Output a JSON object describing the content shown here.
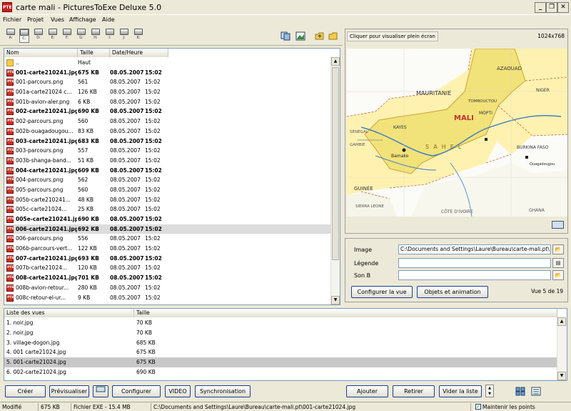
{
  "window": {
    "title": "carte mali - PicturesToExe Deluxe 5.0",
    "icon_text": "PTE"
  },
  "menu": [
    "Fichier",
    "Projet",
    "Vues",
    "Affichage",
    "Aide"
  ],
  "drives": [
    "A:",
    "C:",
    "D:",
    "E:",
    "F:",
    "G:",
    "H:",
    "I:",
    "J:",
    "K:"
  ],
  "filelist": {
    "headers": {
      "name": "Nom",
      "size": "Taille",
      "date": "Date/Heure"
    },
    "rows": [
      {
        "name": "..",
        "size": "Haut",
        "date": "",
        "time": "",
        "icon": "folder-icon"
      },
      {
        "name": "001-carte210241.jpg",
        "size": "675 KB",
        "date": "08.05.2007",
        "time": "15:02",
        "bold": true
      },
      {
        "name": "001-parcours.png",
        "size": "561",
        "date": "08.05.2007",
        "time": "15:02"
      },
      {
        "name": "001a-carte21024 c...",
        "size": "126 KB",
        "date": "08.05.2007",
        "time": "15:02"
      },
      {
        "name": "001b-avion-aler.png",
        "size": "6 KB",
        "date": "08.05.2007",
        "time": "15:02"
      },
      {
        "name": "002-carte210241.jpg",
        "size": "690 KB",
        "date": "08.05.2007",
        "time": "15:02",
        "bold": true
      },
      {
        "name": "002-parcours.png",
        "size": "560",
        "date": "08.05.2007",
        "time": "15:02"
      },
      {
        "name": "002b-ouagadougou...",
        "size": "83 KB",
        "date": "08.05.2007",
        "time": "15:02"
      },
      {
        "name": "003-carte210241.jpg",
        "size": "683 KB",
        "date": "08.05.2007",
        "time": "15:02",
        "bold": true
      },
      {
        "name": "003-parcours.png",
        "size": "557",
        "date": "08.05.2007",
        "time": "15:02"
      },
      {
        "name": "003b-shanga-band...",
        "size": "51 KB",
        "date": "08.05.2007",
        "time": "15:02"
      },
      {
        "name": "004-carte210241.jpg",
        "size": "609 KB",
        "date": "08.05.2007",
        "time": "15:02",
        "bold": true
      },
      {
        "name": "004-parcours.png",
        "size": "562",
        "date": "08.05.2007",
        "time": "15:02"
      },
      {
        "name": "005-parcours.png",
        "size": "560",
        "date": "08.05.2007",
        "time": "15:02"
      },
      {
        "name": "005b-carte210241...",
        "size": "48 KB",
        "date": "08.05.2007",
        "time": "15:02"
      },
      {
        "name": "005c-carte21024...",
        "size": "25 KB",
        "date": "08.05.2007",
        "time": "15:02"
      },
      {
        "name": "005e-carte210241.jpg",
        "size": "690 KB",
        "date": "08.05.2007",
        "time": "15:02",
        "bold": true
      },
      {
        "name": "006-carte210241.jpg",
        "size": "692 KB",
        "date": "08.05.2007",
        "time": "15:02",
        "bold": true,
        "selected": true
      },
      {
        "name": "006-parcours.png",
        "size": "556",
        "date": "08.05.2007",
        "time": "15:02"
      },
      {
        "name": "006b-parcours-vert...",
        "size": "122 KB",
        "date": "08.05.2007",
        "time": "15:02"
      },
      {
        "name": "007-carte210241.jpg",
        "size": "693 KB",
        "date": "08.05.2007",
        "time": "15:02",
        "bold": true
      },
      {
        "name": "007b-carte21024...",
        "size": "120 KB",
        "date": "08.05.2007",
        "time": "15:02"
      },
      {
        "name": "008-carte210241.jpg",
        "size": "701 KB",
        "date": "08.05.2007",
        "time": "15:02",
        "bold": true
      },
      {
        "name": "008b-avion-retour...",
        "size": "280 KB",
        "date": "08.05.2007",
        "time": "15:02"
      },
      {
        "name": "008c-retour-el-ur...",
        "size": "9 KB",
        "date": "08.05.2007",
        "time": "15:02"
      }
    ]
  },
  "preview": {
    "button": "Cliquer pour visualiser plein écran",
    "resolution": "1024x768"
  },
  "map_labels": [
    "AZAOUAD",
    "MAURITANIE",
    "MALI",
    "MOPTI",
    "KAYES",
    "SÉNÉGAL",
    "GAMBIE",
    "GUINÉE",
    "SIERRA LEONE",
    "CÔTE D'IVOIRE",
    "GHANA",
    "BURKINA FASO",
    "Bamako",
    "Ouagadougou",
    "NIGER",
    "TOMBOUCTOU",
    "SAHEL"
  ],
  "props": {
    "image_label": "Image",
    "image_value": "C:\\Documents and Settings\\Laure\\Bureau\\carte-mali.pt\\",
    "legend_label": "Légende",
    "legend_value": "",
    "sound_label": "Son B",
    "sound_value": "",
    "config_btn": "Configurer la vue",
    "objects_btn": "Objets et animation",
    "view_count": "Vue 5 de 19"
  },
  "viewlist": {
    "headers": {
      "name": "Liste des vues",
      "size": "Taille"
    },
    "rows": [
      {
        "name": "1. noir.jpg",
        "size": "70 KB"
      },
      {
        "name": "2. noir.jpg",
        "size": "70 KB"
      },
      {
        "name": "3. village-dogon.jpg",
        "size": "685 KB"
      },
      {
        "name": "4. 001 carte21024.jpg",
        "size": "675 KB"
      },
      {
        "name": "5. 001-carte21024.jpg",
        "size": "675 KB",
        "selected": true
      },
      {
        "name": "6. 002-carte21024.jpg",
        "size": "690 KB"
      }
    ]
  },
  "bottom_buttons": {
    "create": "Créer",
    "preview": "Prévisualiser",
    "configure": "Configurer",
    "video": "VIDEO",
    "sync": "Synchronisation",
    "add": "Ajouter",
    "remove": "Retirer",
    "clear": "Vider la liste"
  },
  "status": {
    "modified": "Modifié",
    "size": "675 KB",
    "exe": "Fichier EXE - 15.4 MB",
    "path": "C:\\Documents and Settings\\Laure\\Bureau\\carte-mali.pt\\001-carte21024.jpg",
    "keep_points": "Maintenir les points"
  }
}
